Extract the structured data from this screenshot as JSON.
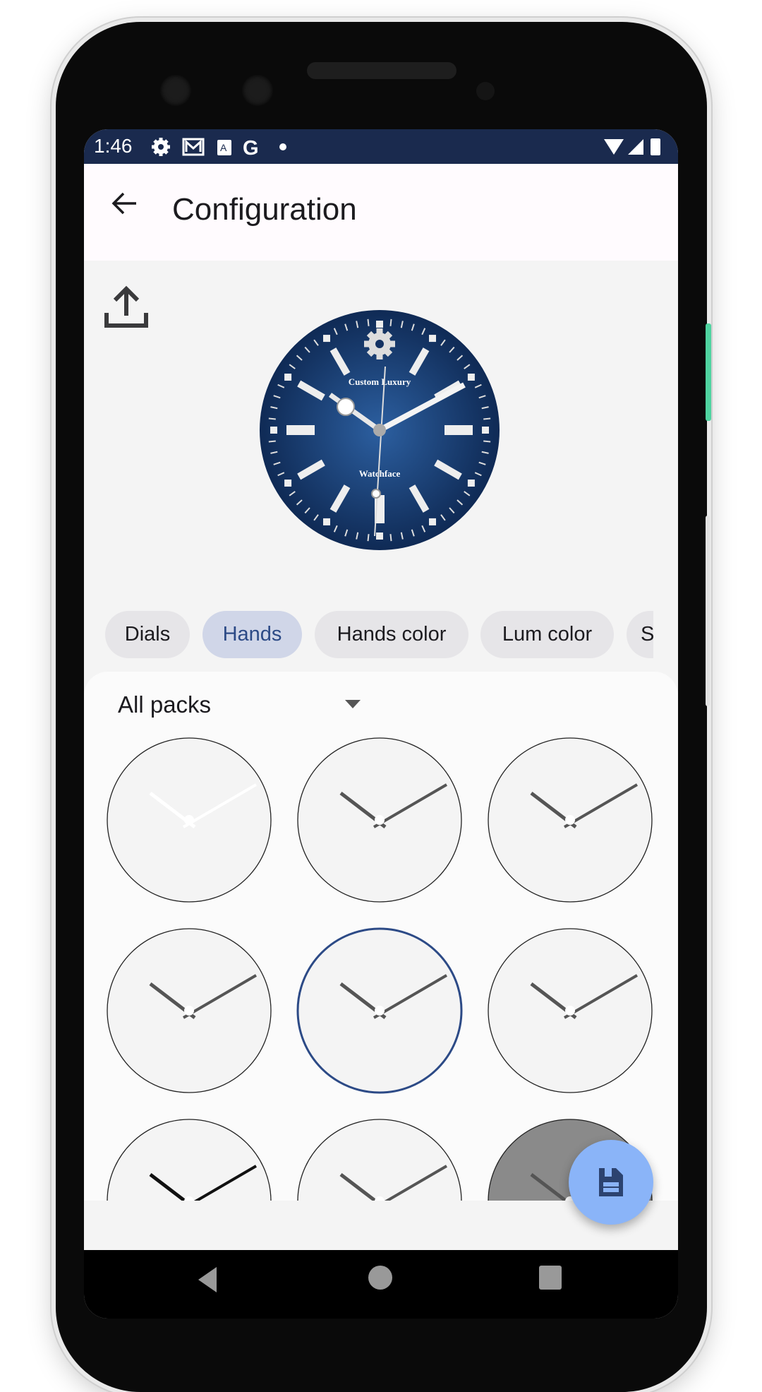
{
  "status_bar": {
    "time": "1:46",
    "icons": [
      "settings-icon",
      "gmail-icon",
      "a-icon",
      "google-icon",
      "dot-icon",
      "wifi-icon",
      "signal-icon",
      "battery-icon"
    ]
  },
  "app_bar": {
    "title": "Configuration",
    "back_icon": "arrow-back-icon"
  },
  "preview": {
    "upload_icon": "upload-icon",
    "dial_text_top": "Custom Luxury",
    "dial_text_bottom": "Watchface",
    "dial_color": "#1f4a85"
  },
  "tabs": [
    {
      "label": "Dials",
      "selected": false
    },
    {
      "label": "Hands",
      "selected": true
    },
    {
      "label": "Hands color",
      "selected": false
    },
    {
      "label": "Lum color",
      "selected": false
    },
    {
      "label": "S",
      "selected": false
    }
  ],
  "filter": {
    "selected": "All packs"
  },
  "hands_grid": {
    "selected_index": 4,
    "count_visible": 9
  },
  "fab": {
    "icon": "save-icon",
    "color": "#8ab4f8"
  },
  "colors": {
    "status_bar": "#1a2a4e",
    "selected_chip": "#d0d6e8",
    "selected_border": "#2c4a86"
  }
}
